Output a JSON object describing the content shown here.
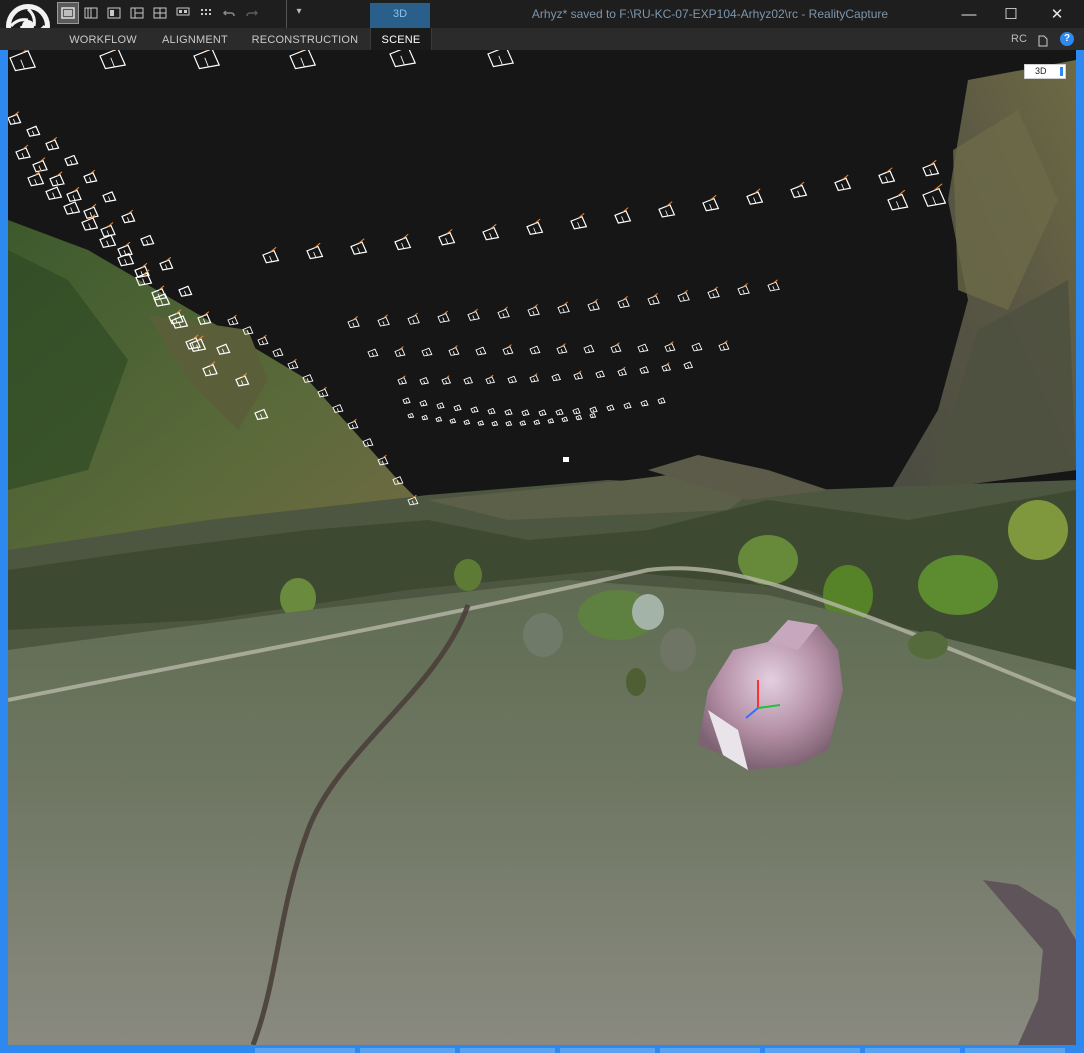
{
  "window": {
    "title": "Arhyz* saved to F:\\RU-KC-07-EXP104-Arhyz02\\rc - RealityCapture",
    "minimize_glyph": "—",
    "maximize_glyph": "☐",
    "close_glyph": "✕"
  },
  "toolbar": {
    "context_tab": "3D",
    "quick_access_glyph": "▾",
    "layout_icons": [
      "layout-1-icon",
      "layout-2-icon",
      "layout-3-icon",
      "layout-4-icon",
      "layout-grid-icon",
      "layout-split-icon",
      "layout-dots-icon"
    ],
    "undo_icon": "undo-icon",
    "redo_icon": "redo-icon"
  },
  "ribbon": {
    "tabs": [
      {
        "label": "WORKFLOW"
      },
      {
        "label": "ALIGNMENT"
      },
      {
        "label": "RECONSTRUCTION"
      },
      {
        "label": "SCENE"
      }
    ],
    "active_tab": "SCENE",
    "right_label": "RC",
    "help_glyph": "?"
  },
  "viewport": {
    "badge": "3D",
    "colors": {
      "sky": "#161616",
      "ground": "#6f7561",
      "accent": "#2d89ef"
    }
  }
}
